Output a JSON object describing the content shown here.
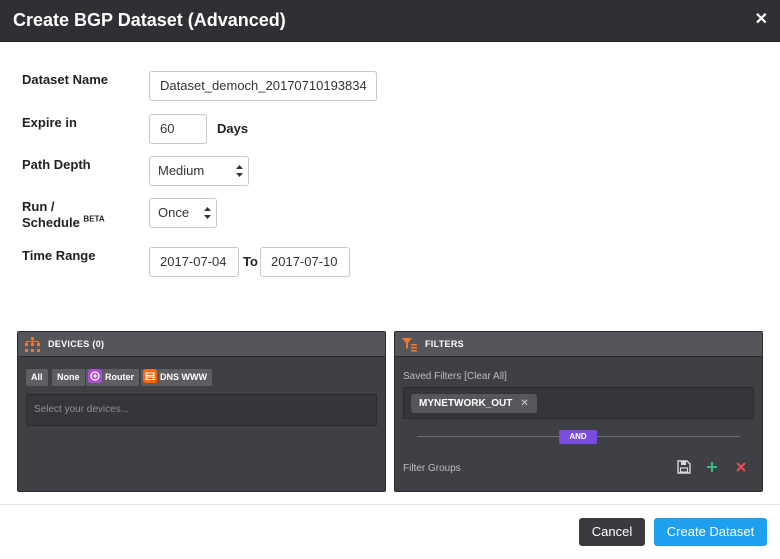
{
  "dialog": {
    "title": "Create BGP Dataset (Advanced)",
    "close_glyph": "✕"
  },
  "form": {
    "dataset_name": {
      "label": "Dataset Name",
      "value": "Dataset_democh_20170710193834"
    },
    "expire": {
      "label": "Expire in",
      "value": "60",
      "unit": "Days"
    },
    "path_depth": {
      "label": "Path Depth",
      "selected": "Medium"
    },
    "run_schedule": {
      "label_line1": "Run /",
      "label_line2": "Schedule",
      "badge": "BETA",
      "selected": "Once"
    },
    "time_range": {
      "label": "Time Range",
      "from": "2017-07-04",
      "to_label": "To",
      "to": "2017-07-10"
    }
  },
  "devices_panel": {
    "title": "DEVICES (0)",
    "icon": "devices-icon",
    "chips": {
      "all": "All",
      "none": "None",
      "router": "Router",
      "dns": "DNS WWW"
    },
    "placeholder": "Select your devices..."
  },
  "filters_panel": {
    "title": "FILTERS",
    "icon": "filter-icon",
    "saved_label": "Saved Filters [Clear All]",
    "tag": "MYNETWORK_OUT",
    "tag_remove": "✕",
    "and_label": "AND",
    "groups_label": "Filter Groups"
  },
  "footer": {
    "cancel_label": "Cancel",
    "create_label": "Create Dataset"
  },
  "colors": {
    "titlebar": "#2f3034",
    "panel": "#3f4045",
    "accent_blue": "#1ea0ef",
    "and_purple": "#7b4ce0",
    "router_purple": "#b04ad8",
    "dns_orange": "#f06a1a",
    "add_green": "#2fc27a",
    "delete_red": "#ef4b5a"
  }
}
